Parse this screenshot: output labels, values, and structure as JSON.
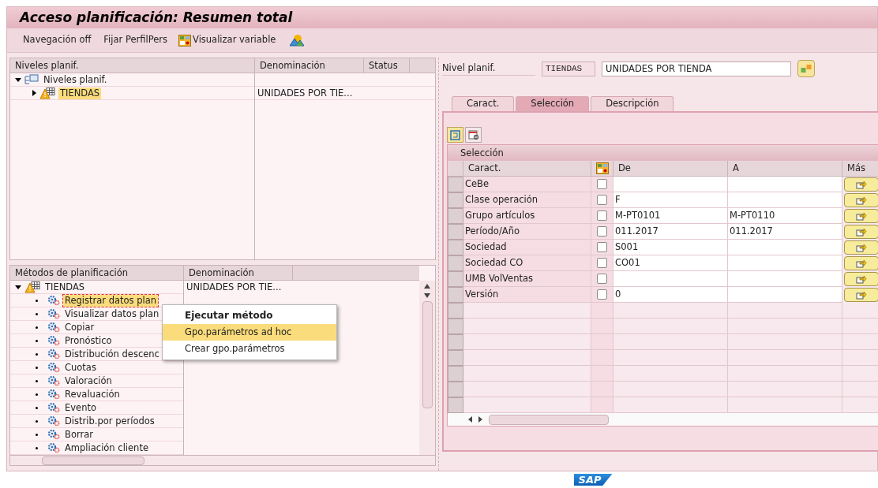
{
  "title": "Acceso planificación: Resumen total",
  "toolbar": [
    {
      "kind": "text",
      "label": "Navegación off"
    },
    {
      "kind": "text",
      "label": "Fijar PerfilPers"
    },
    {
      "kind": "variable",
      "label": "Visualizar variable"
    },
    {
      "kind": "landscape"
    }
  ],
  "levels_tree": {
    "columns": [
      "Niveles planif.",
      "Denominación",
      "Status"
    ],
    "nodes": [
      {
        "kind": "hierarchy",
        "label": "Niveles planif.",
        "expanded": true,
        "selected": false,
        "children": [
          {
            "kind": "level",
            "label": "TIENDAS",
            "description": "UNIDADES POR TIE...",
            "expanded": false,
            "selected": true
          }
        ]
      }
    ]
  },
  "methods_tree": {
    "columns": [
      "Métodos de planificación",
      "Denominación"
    ],
    "nodes": [
      {
        "kind": "level",
        "label": "TIENDAS",
        "description": "UNIDADES POR TIE...",
        "expanded": true,
        "selected": false,
        "children": [
          {
            "kind": "method",
            "label": "Registrar datos plan",
            "selected": true
          },
          {
            "kind": "method",
            "label": "Visualizar datos plan",
            "selected": false
          },
          {
            "kind": "method",
            "label": "Copiar",
            "selected": false
          },
          {
            "kind": "method",
            "label": "Pronóstico",
            "selected": false
          },
          {
            "kind": "method",
            "label": "Distribución descenc",
            "selected": false
          },
          {
            "kind": "method",
            "label": "Cuotas",
            "selected": false
          },
          {
            "kind": "method",
            "label": "Valoración",
            "selected": false
          },
          {
            "kind": "method",
            "label": "Revaluación",
            "selected": false
          },
          {
            "kind": "method",
            "label": "Evento",
            "selected": false
          },
          {
            "kind": "method",
            "label": "Distrib.por períodos",
            "selected": false
          },
          {
            "kind": "method",
            "label": "Borrar",
            "selected": false
          },
          {
            "kind": "method",
            "label": "Ampliación cliente",
            "selected": false
          }
        ]
      }
    ]
  },
  "context_menu": [
    {
      "label": "Ejecutar método",
      "default": true,
      "selected": false
    },
    {
      "label": "Gpo.parámetros ad hoc",
      "default": false,
      "selected": true
    },
    {
      "label": "Crear gpo.parámetros",
      "default": false,
      "selected": false
    }
  ],
  "level_field": {
    "label": "Nivel planif.",
    "code": "TIENDAS",
    "value": "UNIDADES POR TIENDA"
  },
  "tabs": [
    {
      "label": "Caract.",
      "selected": false
    },
    {
      "label": "Selección",
      "selected": true
    },
    {
      "label": "Descripción",
      "selected": false
    }
  ],
  "selection": {
    "title": "Selección",
    "columns": [
      "Caract.",
      "De",
      "A",
      "Más"
    ],
    "rows": [
      {
        "name": "CeBe",
        "checked": false,
        "from": "",
        "to": ""
      },
      {
        "name": "Clase operación",
        "checked": false,
        "from": "F",
        "to": ""
      },
      {
        "name": "Grupo artículos",
        "checked": false,
        "from": "M-PT0101",
        "to": "M-PT0110"
      },
      {
        "name": "Período/Año",
        "checked": false,
        "from": "011.2017",
        "to": "011.2017"
      },
      {
        "name": "Sociedad",
        "checked": false,
        "from": "S001",
        "to": ""
      },
      {
        "name": "Sociedad CO",
        "checked": false,
        "from": "CO01",
        "to": ""
      },
      {
        "name": "UMB VolVentas",
        "checked": false,
        "from": "",
        "to": ""
      },
      {
        "name": "Versión",
        "checked": false,
        "from": "0",
        "to": ""
      }
    ]
  },
  "footer": {
    "logo": "SAP"
  }
}
